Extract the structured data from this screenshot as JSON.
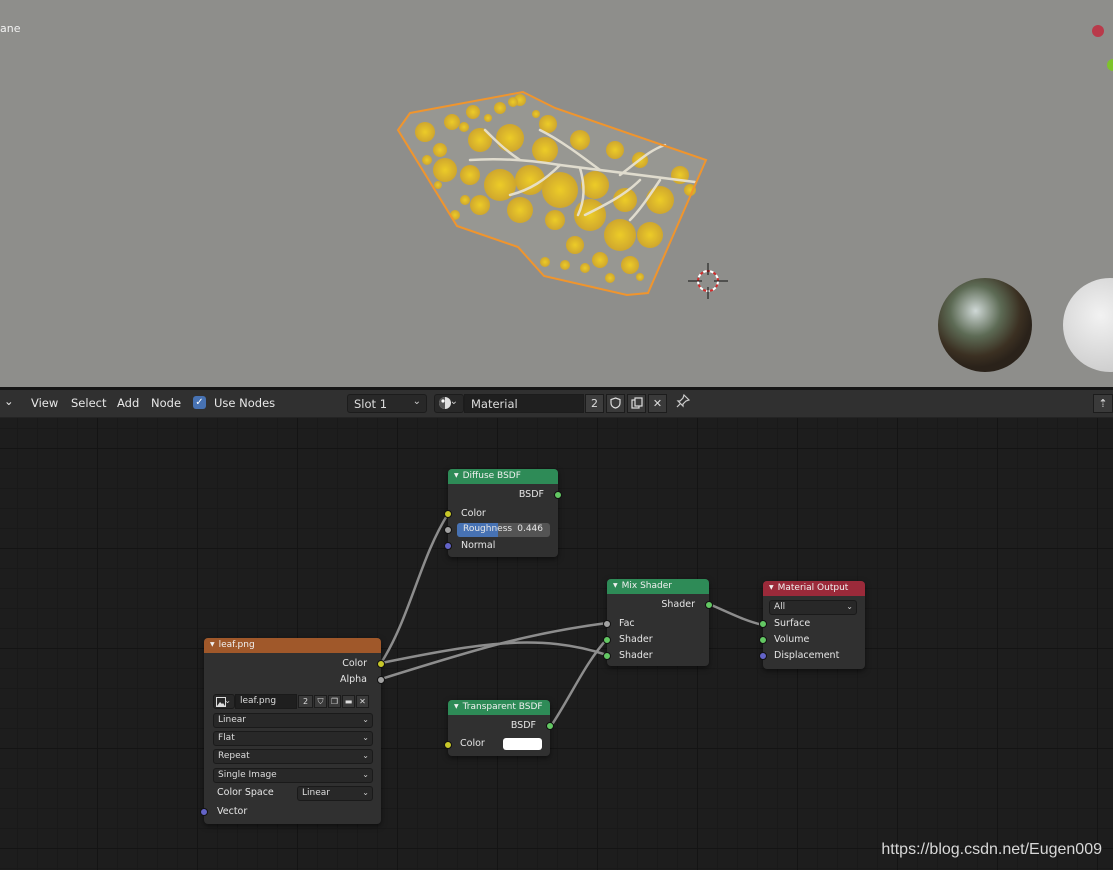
{
  "viewport": {
    "object_label": "ane",
    "colors": {
      "background": "#8e8e8b",
      "selection_outline": "#f0952d",
      "leaf_yellow": "#e8c21f"
    }
  },
  "header": {
    "menu": [
      "View",
      "Select",
      "Add",
      "Node"
    ],
    "use_nodes_label": "Use Nodes",
    "use_nodes_checked": true,
    "slot": "Slot 1",
    "material_name": "Material",
    "user_count": "2",
    "icons": [
      "editor-type-chevron-icon",
      "material-sphere-icon",
      "fake-user-shield-icon",
      "duplicate-icon",
      "unlink-x-icon",
      "pin-icon",
      "collapse-arrow-icon"
    ]
  },
  "nodes": {
    "diffuse": {
      "title": "Diffuse BSDF",
      "output": "BSDF",
      "inputs": {
        "color": "Color",
        "normal": "Normal"
      },
      "roughness": {
        "label": "Roughness",
        "value": "0.446",
        "fraction": 0.446
      },
      "header_color": "#2e8b57"
    },
    "mix": {
      "title": "Mix Shader",
      "output": "Shader",
      "inputs": [
        "Fac",
        "Shader",
        "Shader"
      ],
      "header_color": "#2e8b57"
    },
    "output": {
      "title": "Material Output",
      "target": "All",
      "inputs": [
        "Surface",
        "Volume",
        "Displacement"
      ],
      "header_color": "#9b2a3a"
    },
    "image": {
      "title": "leaf.png",
      "outputs": [
        "Color",
        "Alpha"
      ],
      "image_name": "leaf.png",
      "users": "2",
      "interpolation": "Linear",
      "projection": "Flat",
      "extension": "Repeat",
      "source": "Single Image",
      "color_space_label": "Color Space",
      "color_space": "Linear",
      "vector_label": "Vector",
      "header_color": "#a0582a"
    },
    "transparent": {
      "title": "Transparent BSDF",
      "output": "BSDF",
      "color_label": "Color",
      "color_value": "#ffffff",
      "header_color": "#2e8b57"
    }
  },
  "watermark": "https://blog.csdn.net/Eugen009"
}
